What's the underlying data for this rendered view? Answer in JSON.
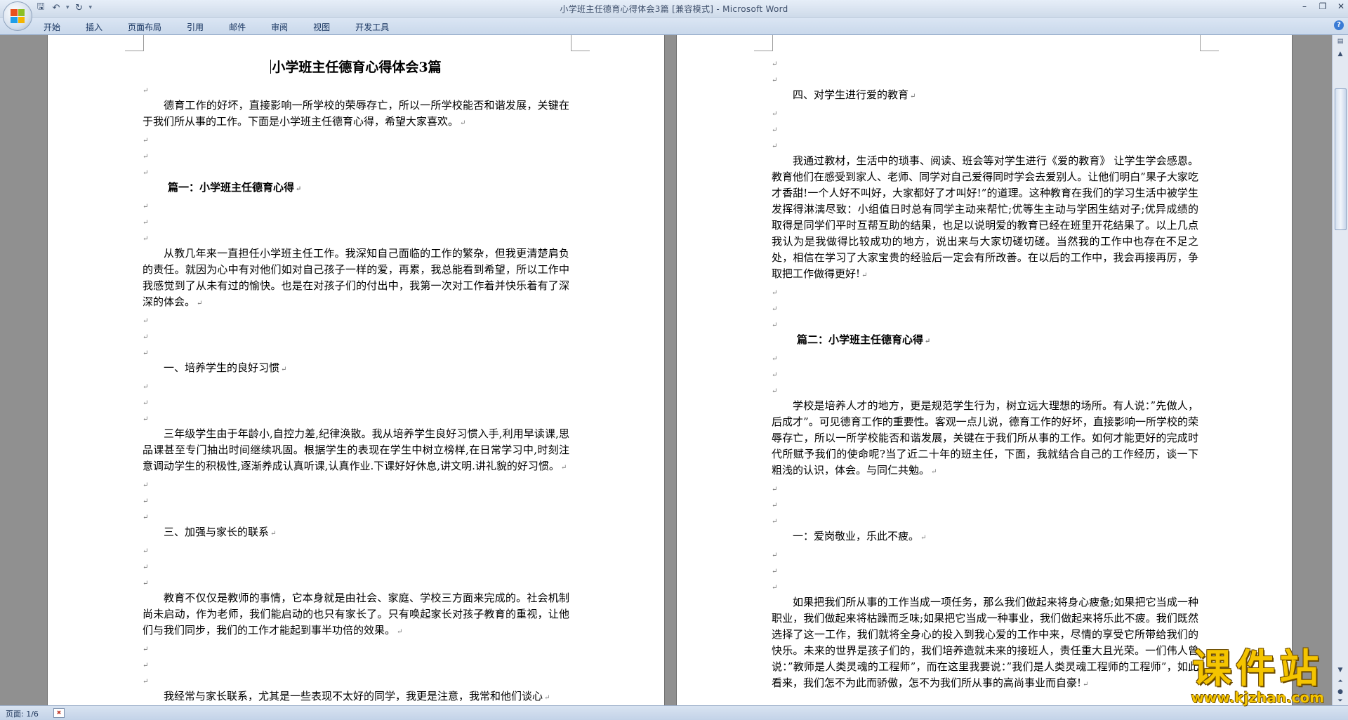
{
  "window": {
    "title": "小学班主任德育心得体会3篇 [兼容模式] - Microsoft Word"
  },
  "ribbon": {
    "tabs": [
      "开始",
      "插入",
      "页面布局",
      "引用",
      "邮件",
      "审阅",
      "视图",
      "开发工具"
    ]
  },
  "document": {
    "mark": "↵",
    "title": "小学班主任德育心得体会3篇",
    "left_page": [
      {
        "type": "blank"
      },
      {
        "type": "p",
        "text": "德育工作的好坏，直接影响一所学校的荣辱存亡，所以一所学校能否和谐发展，关键在于我们所从事的工作。下面是小学班主任德育心得，希望大家喜欢。"
      },
      {
        "type": "blank"
      },
      {
        "type": "blank"
      },
      {
        "type": "blank"
      },
      {
        "type": "heading",
        "text": "篇一：小学班主任德育心得"
      },
      {
        "type": "blank"
      },
      {
        "type": "blank"
      },
      {
        "type": "blank"
      },
      {
        "type": "p",
        "text": "从教几年来一直担任小学班主任工作。我深知自己面临的工作的繁杂，但我更清楚肩负的责任。就因为心中有对他们如对自己孩子一样的爱，再累，我总能看到希望，所以工作中我感觉到了从未有过的愉快。也是在对孩子们的付出中，我第一次对工作着并快乐着有了深深的体会。"
      },
      {
        "type": "blank"
      },
      {
        "type": "blank"
      },
      {
        "type": "blank"
      },
      {
        "type": "sub",
        "text": "一、培养学生的良好习惯"
      },
      {
        "type": "blank"
      },
      {
        "type": "blank"
      },
      {
        "type": "blank"
      },
      {
        "type": "p",
        "text": "三年级学生由于年龄小,自控力差,纪律涣散。我从培养学生良好习惯入手,利用早读课,思品课甚至专门抽出时间继续巩固。根据学生的表现在学生中树立榜样,在日常学习中,时刻注意调动学生的积极性,逐渐养成认真听课,认真作业.下课好好休息,讲文明.讲礼貌的好习惯。"
      },
      {
        "type": "blank"
      },
      {
        "type": "blank"
      },
      {
        "type": "blank"
      },
      {
        "type": "sub",
        "text": "三、加强与家长的联系"
      },
      {
        "type": "blank"
      },
      {
        "type": "blank"
      },
      {
        "type": "blank"
      },
      {
        "type": "p",
        "text": "教育不仅仅是教师的事情，它本身就是由社会、家庭、学校三方面来完成的。社会机制尚未启动，作为老师，我们能启动的也只有家长了。只有唤起家长对孩子教育的重视，让他们与我们同步，我们的工作才能起到事半功倍的效果。"
      },
      {
        "type": "blank"
      },
      {
        "type": "blank"
      },
      {
        "type": "blank"
      },
      {
        "type": "p",
        "text": "我经常与家长联系，尤其是一些表现不太好的同学，我更是注意，我常和他们谈心"
      }
    ],
    "right_page": [
      {
        "type": "blank"
      },
      {
        "type": "blank"
      },
      {
        "type": "sub",
        "text": "四、对学生进行爱的教育"
      },
      {
        "type": "blank"
      },
      {
        "type": "blank"
      },
      {
        "type": "blank"
      },
      {
        "type": "p",
        "text": "我通过教材，生活中的琐事、阅读、班会等对学生进行《爱的教育》 让学生学会感恩。教育他们在感受到家人、老师、同学对自己爱得同时学会去爱别人。让他们明白”果子大家吃才香甜!一个人好不叫好，大家都好了才叫好!”的道理。这种教育在我们的学习生活中被学生发挥得淋漓尽致：小组值日时总有同学主动来帮忙;优等生主动与学困生结对子;优异成绩的取得是同学们平时互帮互助的结果，也足以说明爱的教育已经在班里开花结果了。以上几点我认为是我做得比较成功的地方，说出来与大家切磋切磋。当然我的工作中也存在不足之处，相信在学习了大家宝贵的经验后一定会有所改善。在以后的工作中，我会再接再厉，争取把工作做得更好!"
      },
      {
        "type": "blank"
      },
      {
        "type": "blank"
      },
      {
        "type": "blank"
      },
      {
        "type": "heading",
        "text": "篇二：小学班主任德育心得"
      },
      {
        "type": "blank"
      },
      {
        "type": "blank"
      },
      {
        "type": "blank"
      },
      {
        "type": "p",
        "text": "学校是培养人才的地方，更是规范学生行为，树立远大理想的场所。有人说：”先做人，后成才”。可见德育工作的重要性。客观一点儿说，德育工作的好坏，直接影响一所学校的荣辱存亡，所以一所学校能否和谐发展，关键在于我们所从事的工作。如何才能更好的完成时代所赋予我们的使命呢?当了近二十年的班主任，下面，我就结合自己的工作经历，谈一下粗浅的认识，体会。与同仁共勉。"
      },
      {
        "type": "blank"
      },
      {
        "type": "blank"
      },
      {
        "type": "blank"
      },
      {
        "type": "sub",
        "text": "一：爱岗敬业，乐此不疲。"
      },
      {
        "type": "blank"
      },
      {
        "type": "blank"
      },
      {
        "type": "blank"
      },
      {
        "type": "p",
        "text": "如果把我们所从事的工作当成一项任务，那么我们做起来将身心疲惫;如果把它当成一种职业，我们做起来将枯躁而乏味;如果把它当成一种事业，我们做起来将乐此不疲。我们既然选择了这一工作，我们就将全身心的投入到我心爱的工作中来，尽情的享受它所带给我们的快乐。未来的世界是孩子们的，我们培养造就未来的接班人，责任重大且光荣。一们伟人曾说：”教师是人类灵魂的工程师”，而在这里我要说：”我们是人类灵魂工程师的工程师”，如此看来，我们怎不为此而骄傲，怎不为我们所从事的高尚事业而自豪!"
      }
    ]
  },
  "statusbar": {
    "page": "页面: 1/6"
  },
  "watermark": {
    "text": "课件站",
    "url": "www.kjzhan.com"
  }
}
